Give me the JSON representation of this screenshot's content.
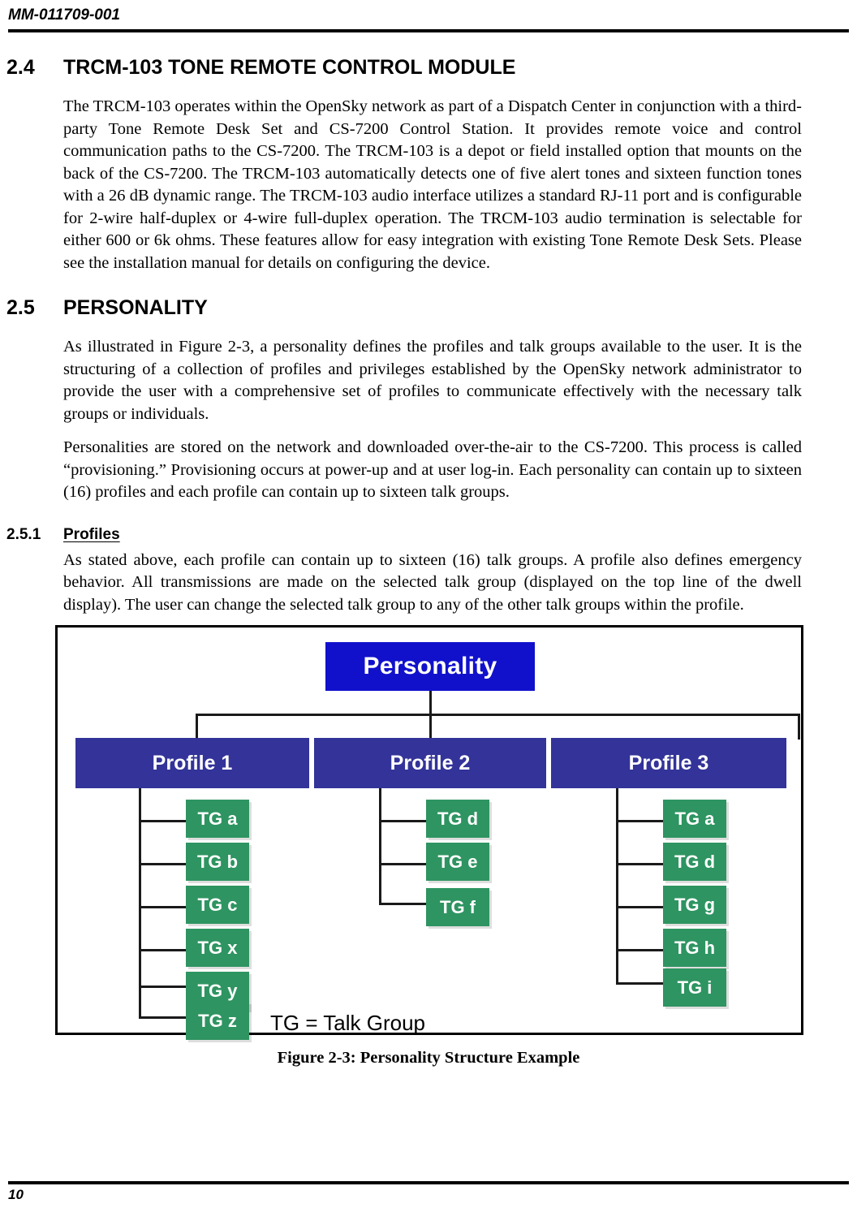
{
  "header": {
    "document_id": "MM-011709-001"
  },
  "footer": {
    "page_number": "10"
  },
  "sections": [
    {
      "number": "2.4",
      "title": "TRCM-103 TONE REMOTE CONTROL MODULE",
      "paragraphs": [
        "The TRCM-103 operates within the OpenSky network as part of a Dispatch Center in conjunction with a third-party Tone Remote Desk Set and CS-7200 Control Station. It provides remote voice and control communication paths to the CS-7200. The TRCM-103 is a depot or field installed option that mounts on the back of the CS-7200. The TRCM-103 automatically detects one of five alert tones and sixteen function tones with a 26 dB dynamic range. The TRCM-103 audio interface utilizes a standard RJ-11 port and is configurable for 2-wire half-duplex or 4-wire full-duplex operation. The TRCM-103 audio termination is selectable for either 600 or 6k ohms. These features allow for easy integration with existing Tone Remote Desk Sets. Please see the installation manual for details on configuring the device."
      ]
    },
    {
      "number": "2.5",
      "title": "PERSONALITY",
      "paragraphs": [
        "As illustrated in Figure 2-3, a personality defines the profiles and talk groups available to the user. It is the structuring of a collection of profiles and privileges established by the OpenSky network administrator to provide the user with a comprehensive set of profiles to communicate effectively with the necessary talk groups or individuals.",
        "Personalities are stored on the network and downloaded over-the-air to the CS-7200. This process is called “provisioning.” Provisioning occurs at power-up and at user log-in. Each personality can contain up to sixteen (16) profiles and each profile can contain up to sixteen talk groups."
      ]
    }
  ],
  "subsection": {
    "number": "2.5.1",
    "title": "Profiles",
    "paragraphs": [
      "As stated above, each profile can contain up to sixteen (16) talk groups. A profile also defines emergency behavior. All transmissions are made on the selected talk group (displayed on the top line of the dwell display). The user can change the selected talk group to any of the other talk groups within the profile."
    ]
  },
  "figure": {
    "caption": "Figure 2-3: Personality Structure Example",
    "legend": "TG = Talk Group",
    "root": "Personality",
    "colors": {
      "personality": "#1111cc",
      "profile": "#333399",
      "talkgroup": "#2e9461",
      "connector": "#1a1a1a",
      "border": "#000000",
      "node_text": "#ffffff"
    },
    "profiles": [
      {
        "label": "Profile 1",
        "talk_groups": [
          "TG a",
          "TG b",
          "TG c",
          "TG x",
          "TG y",
          "TG z"
        ]
      },
      {
        "label": "Profile 2",
        "talk_groups": [
          "TG d",
          "TG e",
          "TG f"
        ]
      },
      {
        "label": "Profile 3",
        "talk_groups": [
          "TG a",
          "TG d",
          "TG g",
          "TG h",
          "TG i"
        ]
      }
    ]
  }
}
